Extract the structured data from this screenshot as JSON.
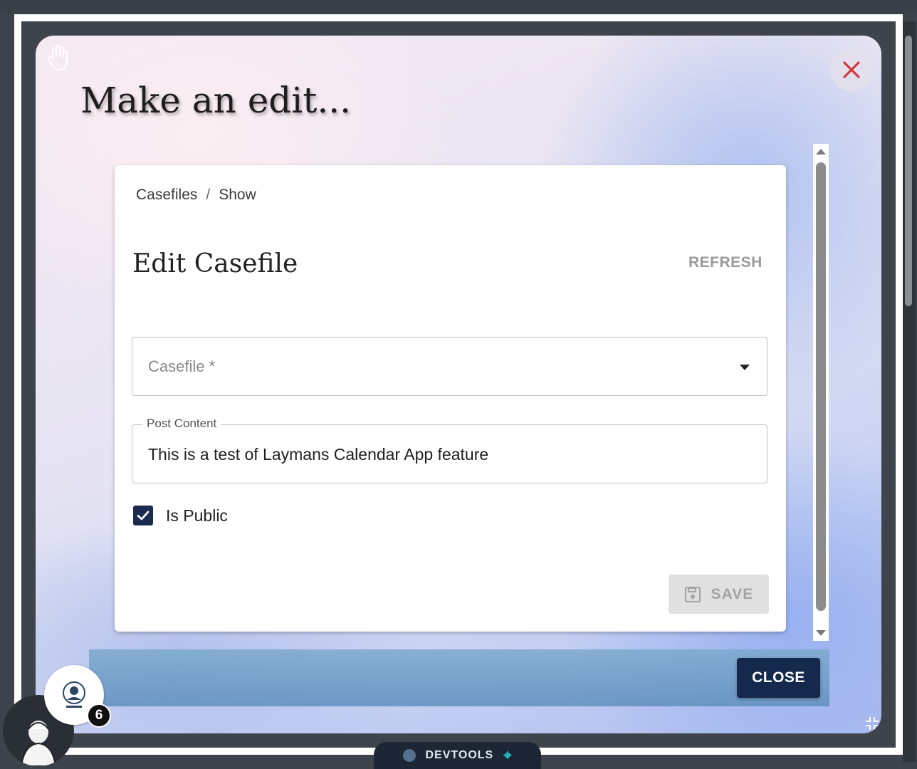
{
  "modal": {
    "title": "Make an edit...",
    "close_icon": "close-icon"
  },
  "breadcrumb": {
    "items": [
      "Casefiles",
      "Show"
    ],
    "separator": "/"
  },
  "form": {
    "title": "Edit Casefile",
    "refresh_label": "REFRESH",
    "casefile_placeholder": "Casefile *",
    "post_content_label": "Post Content",
    "post_content_value": "This is a test of Laymans Calendar App feature",
    "is_public_label": "Is Public",
    "is_public_checked": true,
    "save_label": "SAVE"
  },
  "footer": {
    "close_label": "CLOSE"
  },
  "notifications": {
    "count": "6"
  },
  "devtools": {
    "label": "DEVTOOLS"
  },
  "colors": {
    "primary": "#15294d",
    "close_x": "#d23a3a",
    "checkbox": "#1a2b4f"
  }
}
